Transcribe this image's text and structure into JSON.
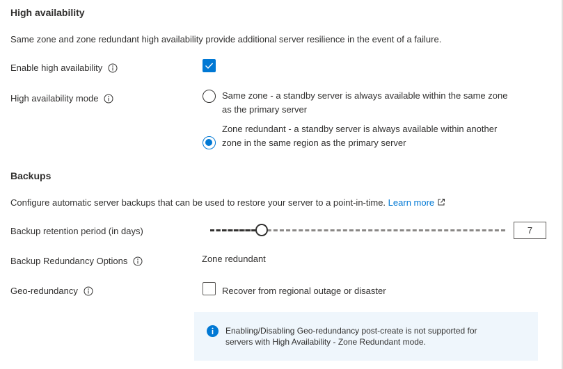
{
  "high_availability": {
    "title": "High availability",
    "description": "Same zone and zone redundant high availability provide additional server resilience in the event of a failure.",
    "enable_label": "Enable high availability",
    "enable_checked": true,
    "mode_label": "High availability mode",
    "modes": [
      {
        "line1": "Same zone - a standby server is always available within the same zone",
        "line2": "as the primary server",
        "selected": false
      },
      {
        "line1": "Zone redundant - a standby server is always available within another",
        "line2": "zone in the same region as the primary server",
        "selected": true
      }
    ]
  },
  "backups": {
    "title": "Backups",
    "description": "Configure automatic server backups that can be used to restore your server to a point-in-time.",
    "learn_more": "Learn more",
    "retention_label": "Backup retention period (in days)",
    "retention_value": "7",
    "redundancy_label": "Backup Redundancy Options",
    "redundancy_value": "Zone redundant",
    "geo_label": "Geo-redundancy",
    "geo_option": "Recover from regional outage or disaster",
    "geo_checked": false,
    "info_line1": "Enabling/Disabling Geo-redundancy post-create is not supported for",
    "info_line2": "servers with High Availability - Zone Redundant mode."
  },
  "colors": {
    "accent": "#0078d4",
    "info_bg": "#eff6fc",
    "text": "#323130"
  },
  "icons": [
    "info-icon",
    "checkmark-icon",
    "external-link-icon",
    "info-filled-icon"
  ]
}
